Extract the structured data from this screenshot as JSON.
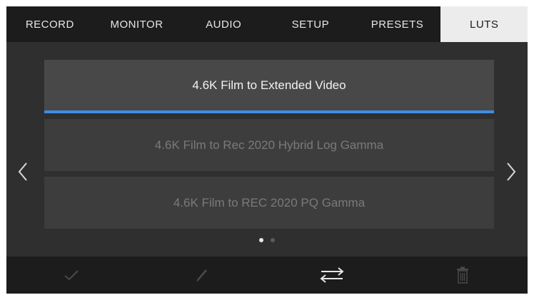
{
  "tabs": [
    {
      "label": "RECORD",
      "active": false
    },
    {
      "label": "MONITOR",
      "active": false
    },
    {
      "label": "AUDIO",
      "active": false
    },
    {
      "label": "SETUP",
      "active": false
    },
    {
      "label": "PRESETS",
      "active": false
    },
    {
      "label": "LUTS",
      "active": true
    }
  ],
  "lut_list": {
    "items": [
      {
        "label": "4.6K Film to Extended Video",
        "selected": true
      },
      {
        "label": "4.6K Film to Rec 2020 Hybrid Log Gamma",
        "selected": false
      },
      {
        "label": "4.6K Film to REC 2020 PQ Gamma",
        "selected": false
      }
    ],
    "page_current": 1,
    "page_count": 2
  },
  "toolbar": {
    "buttons": [
      {
        "icon": "checkmark-icon",
        "enabled": false
      },
      {
        "icon": "pencil-icon",
        "enabled": false
      },
      {
        "icon": "transfer-arrows-icon",
        "enabled": true
      },
      {
        "icon": "trash-icon",
        "enabled": false
      }
    ]
  },
  "colors": {
    "selection_accent": "#3b8ee6",
    "active_tab_bg": "#ececec"
  }
}
